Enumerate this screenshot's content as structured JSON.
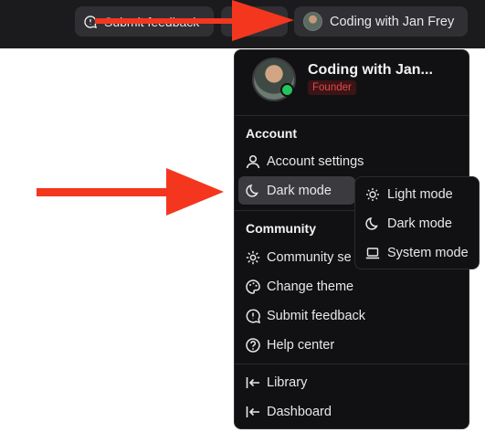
{
  "topbar": {
    "feedback_label": "Submit feedback",
    "user_label": "Coding with Jan Frey"
  },
  "menu": {
    "profile": {
      "name": "Coding with Jan...",
      "role": "Founder"
    },
    "sections": {
      "account_title": "Account",
      "community_title": "Community"
    },
    "items": {
      "account_settings": "Account settings",
      "dark_mode": "Dark mode",
      "community_settings": "Community se",
      "change_theme": "Change theme",
      "submit_feedback": "Submit feedback",
      "help_center": "Help center",
      "library": "Library",
      "dashboard": "Dashboard"
    }
  },
  "theme_submenu": {
    "light": "Light mode",
    "dark": "Dark mode",
    "system": "System mode"
  },
  "colors": {
    "topbar_bg": "#1b1b1d",
    "menu_bg": "#111113",
    "online": "#22c55e",
    "role_badge_text": "#e5484d",
    "annotation_arrow": "#f4361f"
  },
  "icons": {
    "feedback": "chat-bubble-icon",
    "help": "help-circle-icon",
    "account": "user-icon",
    "dark": "moon-icon",
    "light": "sun-icon",
    "system": "laptop-icon",
    "community_settings": "gear-icon",
    "theme": "palette-icon",
    "library": "arrow-left-bar-icon"
  }
}
